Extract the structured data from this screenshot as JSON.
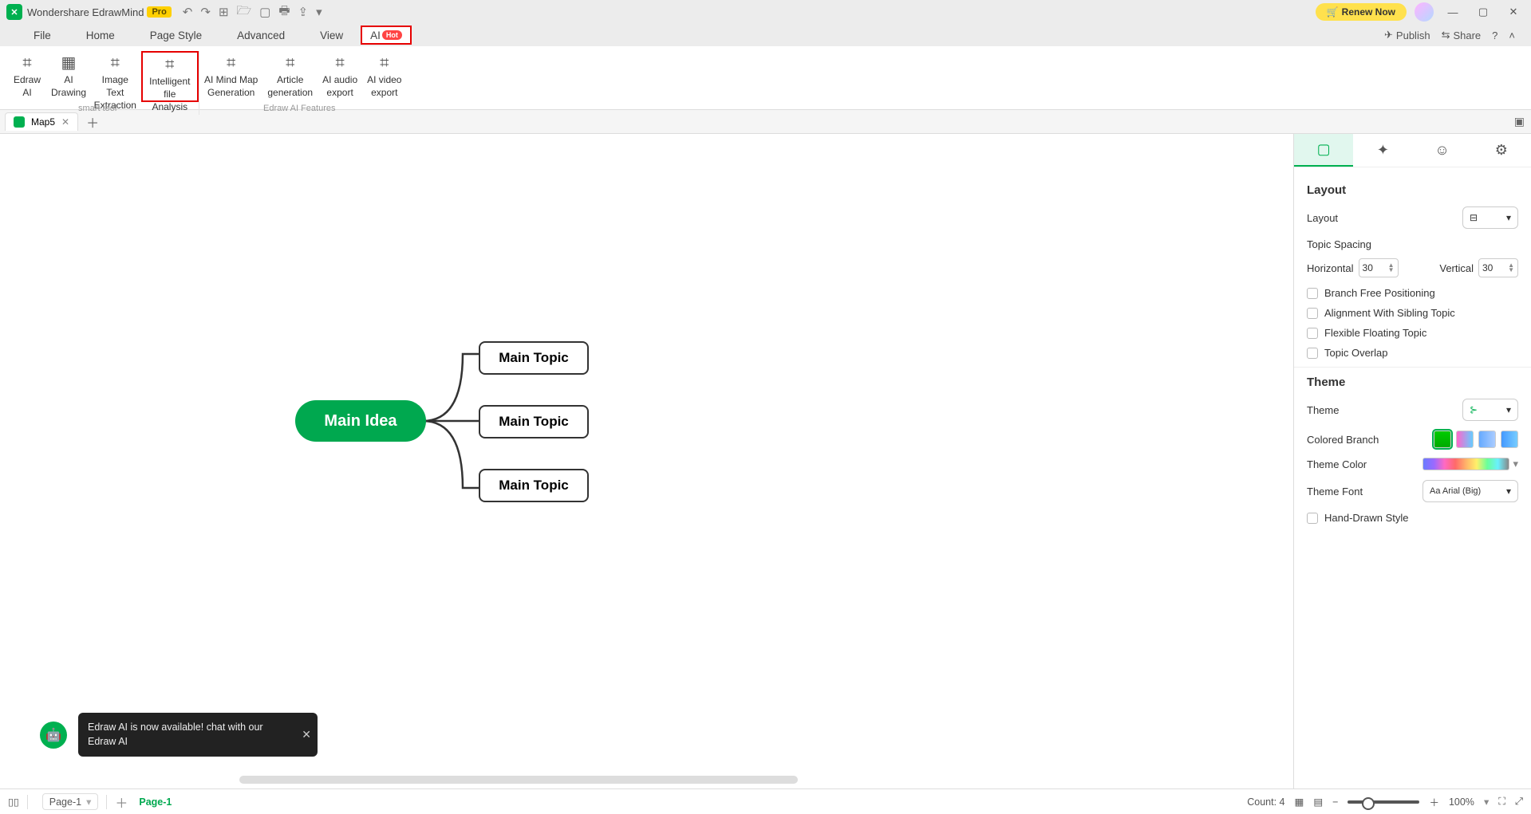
{
  "title": {
    "app": "Wondershare EdrawMind",
    "badge": "Pro",
    "renew": "Renew Now"
  },
  "menu": {
    "items": [
      "File",
      "Home",
      "Page Style",
      "Advanced",
      "View",
      "AI"
    ],
    "hot": "Hot",
    "right": {
      "publish": "Publish",
      "share": "Share"
    }
  },
  "ribbon": {
    "buttons": [
      {
        "l1": "Edraw",
        "l2": "AI"
      },
      {
        "l1": "AI",
        "l2": "Drawing"
      },
      {
        "l1": "Image Text",
        "l2": "Extraction"
      },
      {
        "l1": "Intelligent",
        "l2": "file Analysis",
        "hl": true
      },
      {
        "l1": "AI Mind Map",
        "l2": "Generation"
      },
      {
        "l1": "Article",
        "l2": "generation"
      },
      {
        "l1": "AI audio",
        "l2": "export"
      },
      {
        "l1": "AI video",
        "l2": "export"
      }
    ],
    "group1": "smart tool",
    "group2": "Edraw AI Features"
  },
  "doctab": {
    "name": "Map5"
  },
  "mind": {
    "root": "Main Idea",
    "topics": [
      "Main Topic",
      "Main Topic",
      "Main Topic"
    ]
  },
  "toast": "Edraw AI is now available!  chat with our Edraw AI",
  "panel": {
    "layout_title": "Layout",
    "layout_label": "Layout",
    "spacing": "Topic Spacing",
    "horiz": "Horizontal",
    "vert": "Vertical",
    "hval": "30",
    "vval": "30",
    "checks": [
      "Branch Free Positioning",
      "Alignment With Sibling Topic",
      "Flexible Floating Topic",
      "Topic Overlap"
    ],
    "theme_title": "Theme",
    "theme_label": "Theme",
    "branch": "Colored Branch",
    "tcolor": "Theme Color",
    "tfont_l": "Theme Font",
    "tfont_v": "Arial (Big)",
    "hand": "Hand-Drawn Style"
  },
  "status": {
    "page_sel": "Page-1",
    "page_chip": "Page-1",
    "count": "Count: 4",
    "zoom": "100%"
  }
}
